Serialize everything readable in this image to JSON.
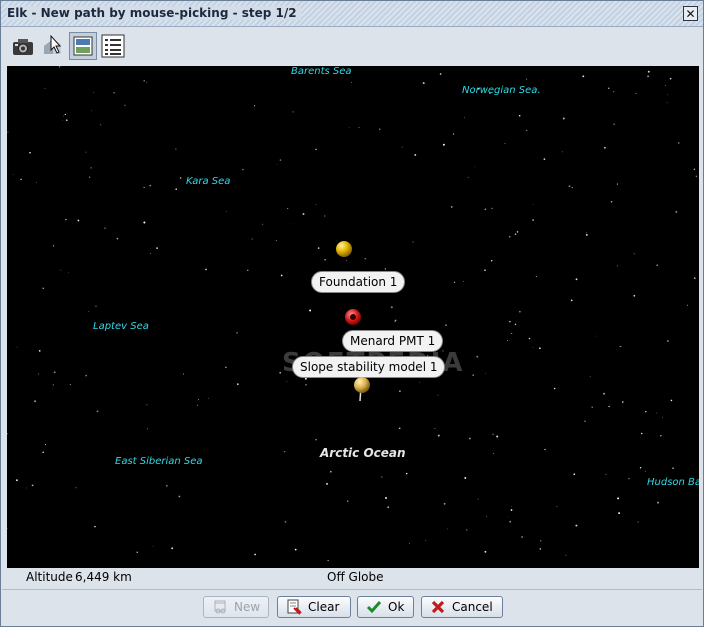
{
  "window": {
    "title": "Elk - New path by mouse-picking - step 1/2",
    "close_glyph": "✕"
  },
  "toolbar": {
    "tools": [
      {
        "icon": "camera-icon"
      },
      {
        "icon": "pick-cursor-icon"
      },
      {
        "icon": "layers-panel-icon",
        "active": true
      },
      {
        "icon": "list-icon"
      }
    ]
  },
  "globe": {
    "seas": [
      "Barents Sea",
      "Norwegian Sea.",
      "Kara Sea",
      "Laptev Sea",
      "East Siberian Sea",
      "Hudson Ba"
    ],
    "ocean": "Arctic Ocean",
    "placemarks": {
      "foundation": "Foundation 1",
      "menard": "Menard PMT 1",
      "slope": "Slope stability model 1"
    },
    "watermark": "SOFTPEDIA",
    "pin_colors": {
      "yellow": "#e8b800",
      "red": "#d21a1a",
      "tan": "#d9b24a"
    }
  },
  "status": {
    "altitude_label": "Altitude",
    "altitude_value": "6,449 km",
    "globe_state": "Off Globe"
  },
  "buttons": {
    "new": "New",
    "clear": "Clear",
    "ok": "Ok",
    "cancel": "Cancel"
  }
}
